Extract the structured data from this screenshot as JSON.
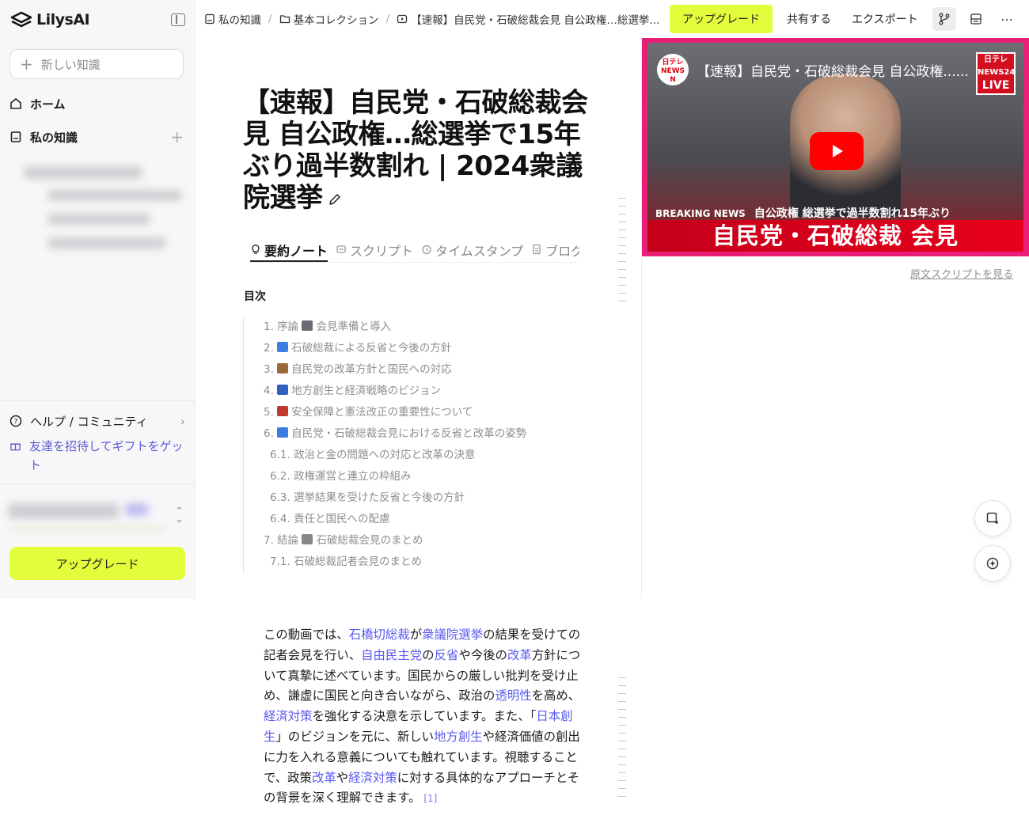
{
  "sidebar": {
    "app_name": "LilysAI",
    "new_knowledge_placeholder": "新しい知識",
    "nav": [
      {
        "label": "ホーム",
        "icon": "home-icon"
      },
      {
        "label": "私の知識",
        "icon": "notebook-icon"
      }
    ],
    "help_label": "ヘルプ / コミュニティ",
    "invite_label": "友達を招待してギフトをゲット",
    "upgrade_label": "アップグレード"
  },
  "breadcrumb": {
    "items": [
      "私の知識",
      "基本コレクション",
      "【速報】自民党・石破総裁会見 自公政権…総選挙..."
    ]
  },
  "topbar": {
    "upgrade_label": "アップグレード",
    "share_label": "共有する",
    "export_label": "エクスポート"
  },
  "document": {
    "title": "【速報】自民党・石破総裁会見 自公政権…総選挙で15年ぶり過半数割れ | 2024衆議院選挙",
    "tabs": [
      "要約ノート",
      "スクリプト",
      "タイムスタンプ",
      "ブログ"
    ],
    "toc_label": "目次",
    "toc": [
      {
        "num": "1.",
        "text": "序論",
        "emoji": "microphone",
        "rest": "会見準備と導入",
        "sub": false
      },
      {
        "num": "2.",
        "text": "",
        "emoji": "speaking-head",
        "rest": "石破総裁による反省と今後の方針",
        "sub": false
      },
      {
        "num": "3.",
        "text": "",
        "emoji": "megaphone",
        "rest": "自民党の改革方針と国民への対応",
        "sub": false
      },
      {
        "num": "4.",
        "text": "",
        "emoji": "cityscape",
        "rest": "地方創生と経済戦略のビジョン",
        "sub": false
      },
      {
        "num": "5.",
        "text": "",
        "emoji": "shield",
        "rest": "安全保障と憲法改正の重要性について",
        "sub": false
      },
      {
        "num": "6.",
        "text": "",
        "emoji": "speaking-head",
        "rest": "自民党・石破総裁会見における反省と改革の姿勢",
        "sub": false
      },
      {
        "num": "6.1.",
        "text": "",
        "emoji": "",
        "rest": " 政治と金の問題への対応と改革の決意",
        "sub": true
      },
      {
        "num": "6.2.",
        "text": "",
        "emoji": "",
        "rest": "政権運営と連立の枠組み",
        "sub": true
      },
      {
        "num": "6.3.",
        "text": "",
        "emoji": "",
        "rest": "選挙結果を受けた反省と今後の方針",
        "sub": true
      },
      {
        "num": "6.4.",
        "text": "",
        "emoji": "",
        "rest": " 責任と国民への配慮",
        "sub": true
      },
      {
        "num": "7.",
        "text": "結論",
        "emoji": "newspaper",
        "rest": "石破総裁会見のまとめ",
        "sub": false
      },
      {
        "num": "7.1.",
        "text": "",
        "emoji": "",
        "rest": "石破総裁記者会見のまとめ",
        "sub": true
      }
    ],
    "summary": [
      {
        "t": "この動画では、",
        "k": false
      },
      {
        "t": "石橋切総裁",
        "k": true
      },
      {
        "t": "が",
        "k": false
      },
      {
        "t": "衆議院選挙",
        "k": true
      },
      {
        "t": "の結果を受けての記者会見を行い、",
        "k": false
      },
      {
        "t": "自由民主党",
        "k": true
      },
      {
        "t": "の",
        "k": false
      },
      {
        "t": "反省",
        "k": true
      },
      {
        "t": "や今後の",
        "k": false
      },
      {
        "t": "改革",
        "k": true
      },
      {
        "t": "方針について真摯に述べています。国民からの厳しい批判を受け止め、謙虚に国民と向き合いながら、政治の",
        "k": false
      },
      {
        "t": "透明性",
        "k": true
      },
      {
        "t": "を高め、",
        "k": false
      },
      {
        "t": "経済対策",
        "k": true
      },
      {
        "t": "を強化する決意を示しています。また、「",
        "k": false
      },
      {
        "t": "日本創生",
        "k": true
      },
      {
        "t": "」のビジョンを元に、新しい",
        "k": false
      },
      {
        "t": "地方創生",
        "k": true
      },
      {
        "t": "や経済価値の創出に力を入れる意義についても触れています。視聴することで、政策",
        "k": false
      },
      {
        "t": "改革",
        "k": true
      },
      {
        "t": "や",
        "k": false
      },
      {
        "t": "経済対策",
        "k": true
      },
      {
        "t": "に対する具体的なアプローチとその背景を深く理解できます。",
        "k": false
      }
    ],
    "summary_ref": "[1]"
  },
  "video": {
    "title": "【速報】自民党・石破総裁会見 自公政権......",
    "channel_logo": "日テレ NEWS N",
    "live_badge_top": "日テレ NEWS24",
    "live_badge_bottom": "LIVE",
    "banner_en": "BREAKING NEWS",
    "banner_sub": "自公政権 総選挙で過半数割れ15年ぶり",
    "banner_main": "自民党・石破総裁 会見"
  },
  "source_link": "原文スクリプトを見る",
  "colors": {
    "accent": "#e3fd3c",
    "link": "#5b5bf0",
    "video_frame": "#e81e77"
  }
}
